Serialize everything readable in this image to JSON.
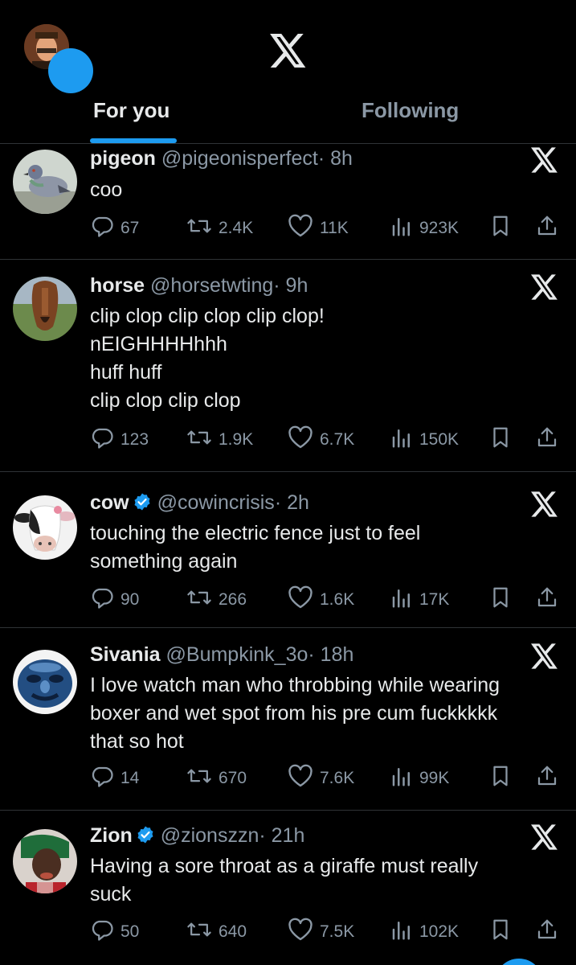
{
  "header": {
    "tabs": [
      {
        "label": "For you",
        "active": true
      },
      {
        "label": "Following",
        "active": false
      }
    ],
    "accent_color": "#1d9bf0"
  },
  "posts": [
    {
      "name": "pigeon",
      "verified": false,
      "handle": "@pigeonisperfect",
      "time": "· 8h",
      "lines": [
        "coo"
      ],
      "replies": "67",
      "reposts": "2.4K",
      "likes": "11K",
      "views": "923K"
    },
    {
      "name": "horse",
      "verified": false,
      "handle": "@horsetwting",
      "time": "· 9h",
      "lines": [
        "clip clop clip clop clip clop!",
        "nEIGHHHHhhh",
        "huff huff",
        "clip clop clip clop"
      ],
      "replies": "123",
      "reposts": "1.9K",
      "likes": "6.7K",
      "views": "150K"
    },
    {
      "name": "cow",
      "verified": true,
      "handle": "@cowincrisis",
      "time": "· 2h",
      "lines": [
        "touching the electric fence just to feel",
        "something again"
      ],
      "replies": "90",
      "reposts": "266",
      "likes": "1.6K",
      "views": "17K"
    },
    {
      "name": "Sivania",
      "verified": false,
      "handle": "@Bumpkink_3o",
      "time": "· 18h",
      "lines": [
        "I love watch man who throbbing while wearing",
        "boxer and wet spot from his pre cum fuckkkkk",
        "that so hot"
      ],
      "replies": "14",
      "reposts": "670",
      "likes": "7.6K",
      "views": "99K"
    },
    {
      "name": "Zion",
      "verified": true,
      "handle": "@zionszzn",
      "time": "· 21h",
      "lines": [
        "Having a sore throat as a giraffe must really",
        "suck"
      ],
      "replies": "50",
      "reposts": "640",
      "likes": "7.5K",
      "views": "102K"
    }
  ],
  "icons": {
    "reply": "reply-icon",
    "repost": "repost-icon",
    "like": "heart-icon",
    "views": "views-icon",
    "bookmark": "bookmark-icon",
    "share": "share-icon",
    "grok": "x-logo-icon",
    "verified": "verified-badge-icon"
  }
}
